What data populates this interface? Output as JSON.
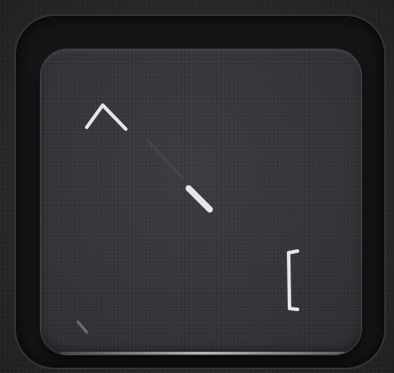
{
  "key": {
    "legend_upper": "^",
    "legend_middle": "\\",
    "legend_lower_right": "[",
    "legend_color": "#e4e6ea",
    "keycap_color": "#333437",
    "deck_color": "#2b2c2e"
  }
}
